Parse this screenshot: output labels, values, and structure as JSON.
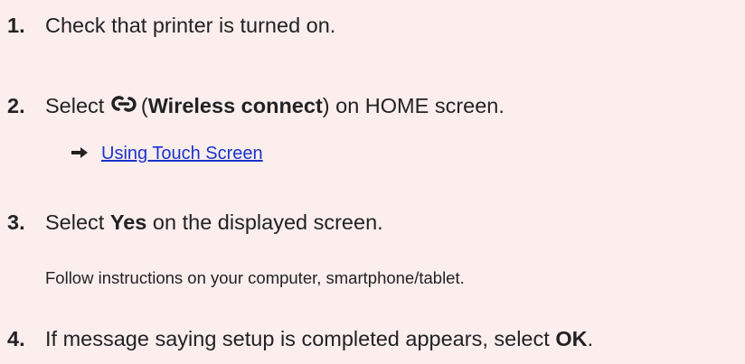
{
  "steps": [
    {
      "number": "1.",
      "text": "Check that printer is turned on."
    },
    {
      "number": "2.",
      "pre": "Select",
      "open_paren": "(",
      "bold": "Wireless connect",
      "post": ") on HOME screen.",
      "icon": "wireless-connect-icon"
    },
    {
      "number": "3.",
      "pre": "Select",
      "bold": "Yes",
      "post": "on the displayed screen."
    },
    {
      "number": "4.",
      "pre": "If message saying setup is completed appears, select",
      "bold": "OK",
      "post": "."
    }
  ],
  "link": {
    "icon": "arrow-right-icon",
    "label": "Using Touch Screen"
  },
  "note": "Follow instructions on your computer, smartphone/tablet.",
  "colors": {
    "background": "#fdeeee",
    "text": "#222222",
    "link": "#1a33cc"
  }
}
